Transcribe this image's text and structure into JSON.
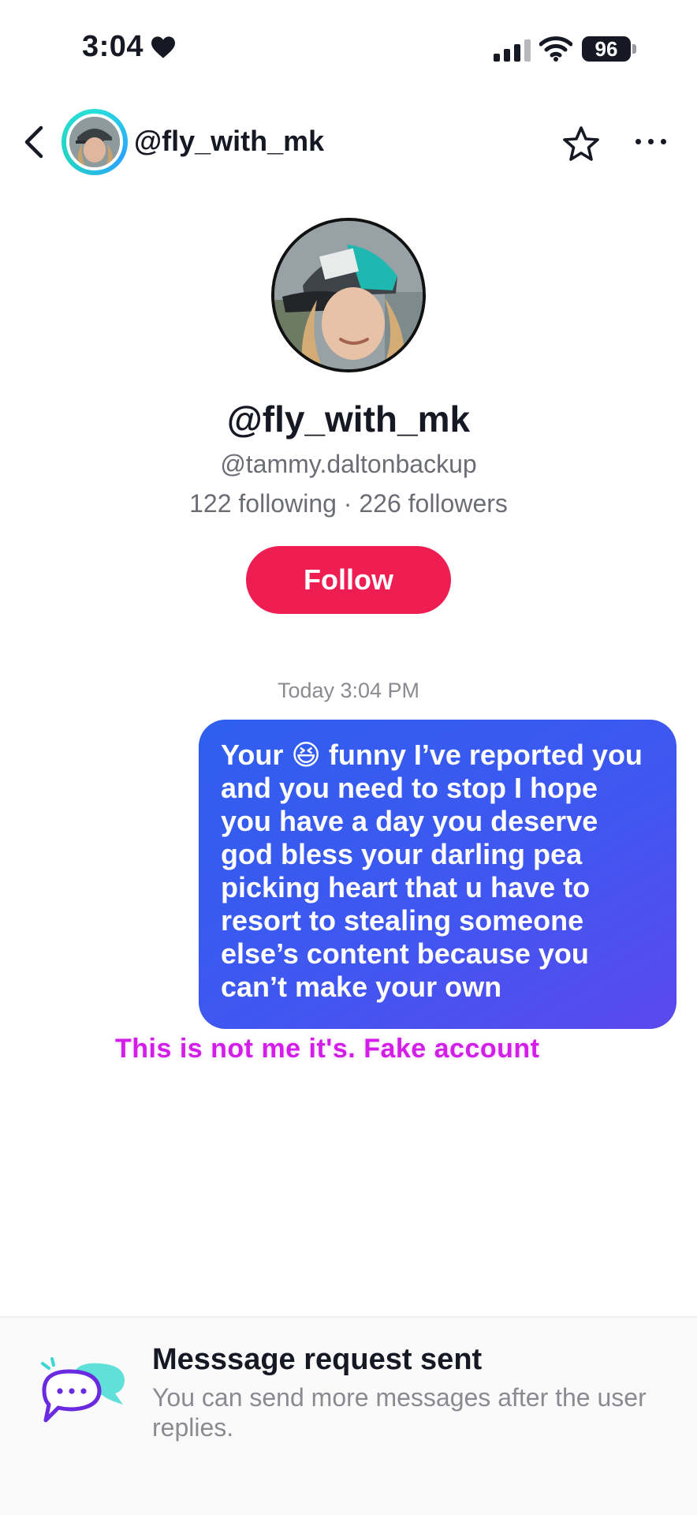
{
  "status_bar": {
    "time": "3:04",
    "battery": "96"
  },
  "header": {
    "name": "@fly_with_mk",
    "icons": [
      "back-icon",
      "avatar",
      "star-icon",
      "more-icon"
    ]
  },
  "profile": {
    "name": "@fly_with_mk",
    "handle": "@tammy.daltonbackup",
    "stats": "122 following · 226 followers",
    "follow_label": "Follow"
  },
  "chat": {
    "timestamp": "Today 3:04 PM",
    "message": "Your 😆 funny I’ve reported you and you need to stop I hope you have a day you deserve god bless your darling pea picking heart that u have to resort to stealing someone else’s content because you can’t make your own",
    "caption": "This is not me it's. Fake account"
  },
  "bottom": {
    "title": "Messsage request sent",
    "subtitle": "You can send more messages after the user replies."
  },
  "colors": {
    "follow": "#ee1d52",
    "bubble_start": "#2f5fee",
    "bubble_end": "#5b49ee",
    "caption": "#d21ee8"
  }
}
